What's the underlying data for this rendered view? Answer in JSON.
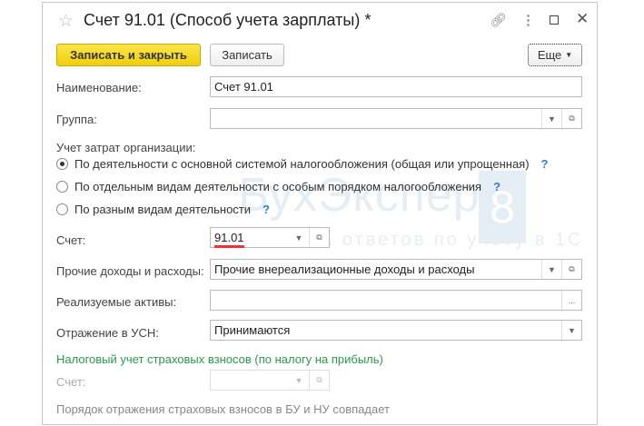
{
  "window": {
    "title": "Счет 91.01 (Способ учета зарплаты) *"
  },
  "toolbar": {
    "save_close": "Записать и закрыть",
    "save": "Записать",
    "more": "Еще"
  },
  "watermark": {
    "brand": "БухЭксперт",
    "digit": "8",
    "tagline": "База ответов по учёту в 1С"
  },
  "form": {
    "name_label": "Наименование:",
    "name_value": "Счет 91.01",
    "group_label": "Группа:",
    "group_value": "",
    "cost_label": "Учет затрат организации:",
    "radios": [
      {
        "label": "По деятельности с основной системой налогообложения (общая или упрощенная)",
        "selected": true
      },
      {
        "label": "По отдельным видам деятельности с особым порядком налогообложения",
        "selected": false
      },
      {
        "label": "По разным видам деятельности",
        "selected": false
      }
    ],
    "help": "?",
    "account_label": "Счет:",
    "account_value": "91.01",
    "other_label": "Прочие доходы и расходы:",
    "other_value": "Прочие внереализационные доходы и расходы",
    "assets_label": "Реализуемые активы:",
    "assets_value": "",
    "assets_btn": "...",
    "usn_label": "Отражение в УСН:",
    "usn_value": "Принимаются",
    "tax_section": "Налоговый учет страховых взносов (по налогу на прибыль)",
    "tax_account_label": "Счет:",
    "tax_account_value": "",
    "footer_note": "Порядок отражения страховых взносов в БУ и НУ совпадает"
  }
}
